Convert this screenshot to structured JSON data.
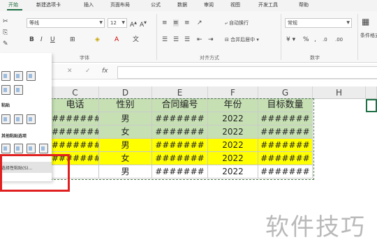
{
  "ribbon_tabs": [
    "开始",
    "新建选项卡",
    "插入",
    "页面布局",
    "公式",
    "数据",
    "审阅",
    "视图",
    "开发工具",
    "帮助"
  ],
  "ribbon": {
    "font_name": "等线",
    "font_size": "12",
    "number_format": "常规",
    "wrap_text": "自动换行",
    "merge_center": "合并后居中",
    "conditional_format": "条件格式",
    "group_font": "字体",
    "group_alignment": "对齐方式",
    "group_number": "数字"
  },
  "formula_bar": {
    "fx": "fx",
    "cancel": "✕",
    "confirm": "✓"
  },
  "columns": [
    "C",
    "D",
    "E",
    "F",
    "G",
    "H"
  ],
  "headers": [
    "电话",
    "性别",
    "合同编号",
    "年份",
    "目标数量"
  ],
  "rows": [
    {
      "phone": "#######",
      "gender": "男",
      "contract": "#######",
      "year": "2022",
      "target": "#######"
    },
    {
      "phone": "#######",
      "gender": "女",
      "contract": "#######",
      "year": "2022",
      "target": "#######"
    },
    {
      "phone": "#######",
      "gender": "男",
      "contract": "#######",
      "year": "2022",
      "target": "#######"
    },
    {
      "phone": "#######",
      "gender": "女",
      "contract": "#######",
      "year": "2022",
      "target": "#######"
    },
    {
      "phone": "",
      "gender": "男",
      "contract": "#######",
      "year": "2022",
      "target": "#######"
    }
  ],
  "paste_menu": {
    "section_values": "粘贴",
    "section_other": "其他粘贴选项",
    "selective_paste": "选择性粘贴(S)..."
  },
  "watermark": "软件技巧",
  "colors": {
    "green_fill": "#c6e0b4",
    "yellow_fill": "#ffff00",
    "highlight_border": "#e02020",
    "excel_green": "#1e7145"
  }
}
